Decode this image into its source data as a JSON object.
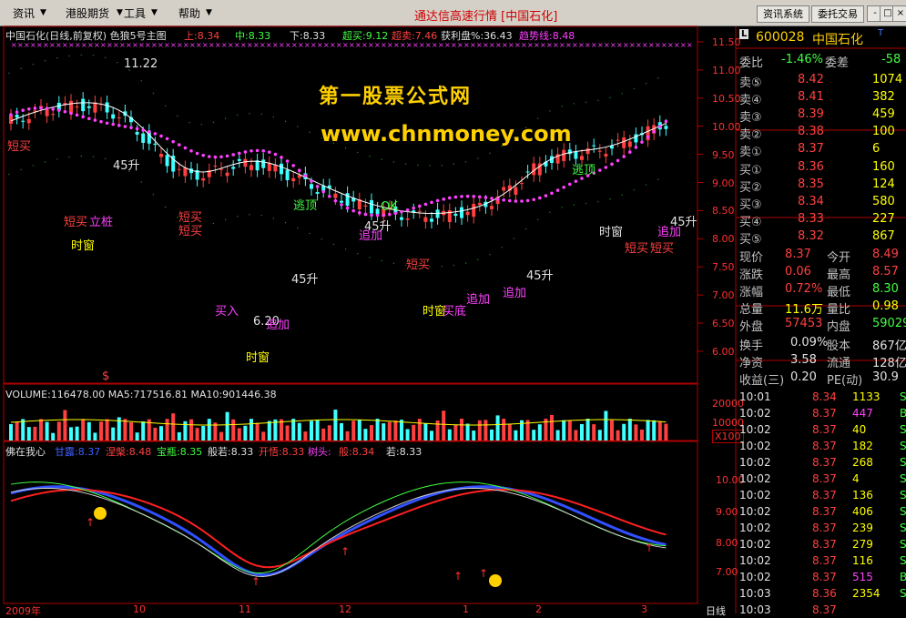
{
  "menu": [
    "资讯",
    "港股期货",
    "工具",
    "帮助"
  ],
  "title": "通达信高速行情 [中国石化]",
  "buttons": {
    "info": "资讯系统",
    "trade": "委托交易"
  },
  "window_controls": [
    "-",
    "□",
    "×"
  ],
  "chart_header": {
    "name": "中国石化(日线,前复权) 色狼5号主图",
    "items": [
      {
        "label": "上:8.34",
        "color": "#ff4040"
      },
      {
        "label": "中:8.33",
        "color": "#40ff40"
      },
      {
        "label": "下:8.33",
        "color": "#e0e0e0"
      },
      {
        "label": "超买:9.12",
        "color": "#40ff40"
      },
      {
        "label": "超卖:7.46",
        "color": "#ff4040"
      },
      {
        "label": "获利盘%:36.43",
        "color": "#e0e0e0"
      },
      {
        "label": "趋势线:8.48",
        "color": "#ff40ff"
      }
    ]
  },
  "price_axis": [
    "11.50",
    "11.00",
    "10.50",
    "10.00",
    "9.50",
    "9.00",
    "8.50",
    "8.00",
    "7.50",
    "7.00",
    "6.50",
    "6.00"
  ],
  "annotations": [
    {
      "t": "11.22",
      "c": "#e0e0e0"
    },
    {
      "t": "短买",
      "c": "#ff4040"
    },
    {
      "t": "45升",
      "c": "#e0e0e0"
    },
    {
      "t": "短买",
      "c": "#ff4040"
    },
    {
      "t": "立桩",
      "c": "#ff40ff"
    },
    {
      "t": "时窗",
      "c": "#ffff00"
    },
    {
      "t": "短买",
      "c": "#ff4040"
    },
    {
      "t": "短买",
      "c": "#ff4040"
    },
    {
      "t": "买入",
      "c": "#ff40ff"
    },
    {
      "t": "6.20",
      "c": "#e0e0e0"
    },
    {
      "t": "追加",
      "c": "#ff40ff"
    },
    {
      "t": "时窗",
      "c": "#ffff00"
    },
    {
      "t": "45升",
      "c": "#e0e0e0"
    },
    {
      "t": "逃顶",
      "c": "#40ff40"
    },
    {
      "t": "45升",
      "c": "#e0e0e0"
    },
    {
      "t": "追加",
      "c": "#ff40ff"
    },
    {
      "t": "OK",
      "c": "#40ff40"
    },
    {
      "t": "短买",
      "c": "#ff4040"
    },
    {
      "t": "时窗",
      "c": "#ffff00"
    },
    {
      "t": "买底",
      "c": "#ff40ff"
    },
    {
      "t": "追加",
      "c": "#ff40ff"
    },
    {
      "t": "追加",
      "c": "#ff40ff"
    },
    {
      "t": "45升",
      "c": "#e0e0e0"
    },
    {
      "t": "逃顶",
      "c": "#40ff40"
    },
    {
      "t": "时窗",
      "c": "#e0e0e0"
    },
    {
      "t": "短买",
      "c": "#ff4040"
    },
    {
      "t": "短买",
      "c": "#ff4040"
    },
    {
      "t": "追加",
      "c": "#ff40ff"
    },
    {
      "t": "45升",
      "c": "#e0e0e0"
    },
    {
      "t": "$",
      "c": "#ff4040"
    }
  ],
  "watermark": {
    "name": "第一股票公式网",
    "url": "www.chnmoney.com"
  },
  "volume": {
    "header": "VOLUME:116478.00  MA5:717516.81  MA10:901446.38",
    "axis": [
      "20000",
      "10000"
    ],
    "unit": "X100"
  },
  "indicator": {
    "name": "佛在我心",
    "items": [
      {
        "label": "甘露:8.37",
        "color": "#4060ff"
      },
      {
        "label": "涅槃:8.48",
        "color": "#ff4040"
      },
      {
        "label": "宝瓶:8.35",
        "color": "#40ff40"
      },
      {
        "label": "般若:8.33",
        "color": "#e0e0e0"
      },
      {
        "label": "开悟:8.33",
        "color": "#ff4040"
      },
      {
        "label": "树头:",
        "color": "#ff40ff"
      },
      {
        "label": "般:8.34",
        "color": "#ff4040"
      },
      {
        "label": "若:8.33",
        "color": "#e0e0e0"
      }
    ],
    "axis": [
      "10.00",
      "9.00",
      "8.00",
      "7.00"
    ]
  },
  "date_axis": [
    "2009年",
    "10",
    "11",
    "12",
    "1",
    "2",
    "3"
  ],
  "date_axis_right": "日线",
  "stock": {
    "code": "600028",
    "name": "中国石化",
    "flag": "T"
  },
  "ratio": {
    "l1": "委比",
    "v1": "-1.46%",
    "l2": "委差",
    "v2": "-58"
  },
  "asks": [
    {
      "label": "卖⑤",
      "price": "8.42",
      "vol": "1074"
    },
    {
      "label": "卖④",
      "price": "8.41",
      "vol": "382"
    },
    {
      "label": "卖③",
      "price": "8.39",
      "vol": "459"
    },
    {
      "label": "卖②",
      "price": "8.38",
      "vol": "100"
    },
    {
      "label": "卖①",
      "price": "8.37",
      "vol": "6"
    }
  ],
  "bids": [
    {
      "label": "买①",
      "price": "8.36",
      "vol": "160"
    },
    {
      "label": "买②",
      "price": "8.35",
      "vol": "124"
    },
    {
      "label": "买③",
      "price": "8.34",
      "vol": "580"
    },
    {
      "label": "买④",
      "price": "8.33",
      "vol": "227"
    },
    {
      "label": "买⑤",
      "price": "8.32",
      "vol": "867"
    }
  ],
  "quote": [
    {
      "l1": "现价",
      "v1": "8.37",
      "c1": "#ff4040",
      "l2": "今开",
      "v2": "8.49",
      "c2": "#ff4040"
    },
    {
      "l1": "涨跌",
      "v1": "0.06",
      "c1": "#ff4040",
      "l2": "最高",
      "v2": "8.57",
      "c2": "#ff4040"
    },
    {
      "l1": "涨幅",
      "v1": "0.72%",
      "c1": "#ff4040",
      "l2": "最低",
      "v2": "8.30",
      "c2": "#40ff40"
    },
    {
      "l1": "总量",
      "v1": "11.6万",
      "c1": "#ffff00",
      "l2": "量比",
      "v2": "0.98",
      "c2": "#ffff00"
    },
    {
      "l1": "外盘",
      "v1": "57453",
      "c1": "#ff4040",
      "l2": "内盘",
      "v2": "59029",
      "c2": "#40ff40"
    }
  ],
  "fundamentals": [
    {
      "l1": "换手",
      "v1": "0.09%",
      "l2": "股本",
      "v2": "867亿"
    },
    {
      "l1": "净资",
      "v1": "3.58",
      "l2": "流通",
      "v2": "128亿"
    },
    {
      "l1": "收益(三)",
      "v1": "0.20",
      "l2": "PE(动)",
      "v2": "30.9"
    }
  ],
  "ticks": [
    {
      "time": "10:01",
      "price": "8.34",
      "vol": "1133",
      "dir": "S"
    },
    {
      "time": "10:02",
      "price": "8.37",
      "vol": "447",
      "dir": "B"
    },
    {
      "time": "10:02",
      "price": "8.37",
      "vol": "40",
      "dir": "S"
    },
    {
      "time": "10:02",
      "price": "8.37",
      "vol": "182",
      "dir": "S"
    },
    {
      "time": "10:02",
      "price": "8.37",
      "vol": "268",
      "dir": "S"
    },
    {
      "time": "10:02",
      "price": "8.37",
      "vol": "4",
      "dir": "S"
    },
    {
      "time": "10:02",
      "price": "8.37",
      "vol": "136",
      "dir": "S"
    },
    {
      "time": "10:02",
      "price": "8.37",
      "vol": "406",
      "dir": "S"
    },
    {
      "time": "10:02",
      "price": "8.37",
      "vol": "239",
      "dir": "S"
    },
    {
      "time": "10:02",
      "price": "8.37",
      "vol": "279",
      "dir": "S"
    },
    {
      "time": "10:02",
      "price": "8.37",
      "vol": "116",
      "dir": "S"
    },
    {
      "time": "10:02",
      "price": "8.37",
      "vol": "515",
      "dir": "B"
    },
    {
      "time": "10:03",
      "price": "8.36",
      "vol": "2354",
      "dir": "S"
    },
    {
      "time": "10:03",
      "price": "8.37",
      "vol": "",
      "dir": ""
    }
  ],
  "colors": {
    "up": "#ff4040",
    "down": "#40ffff",
    "ma": "#ffffff",
    "trend": "#ff40ff",
    "border": "#b00000"
  }
}
